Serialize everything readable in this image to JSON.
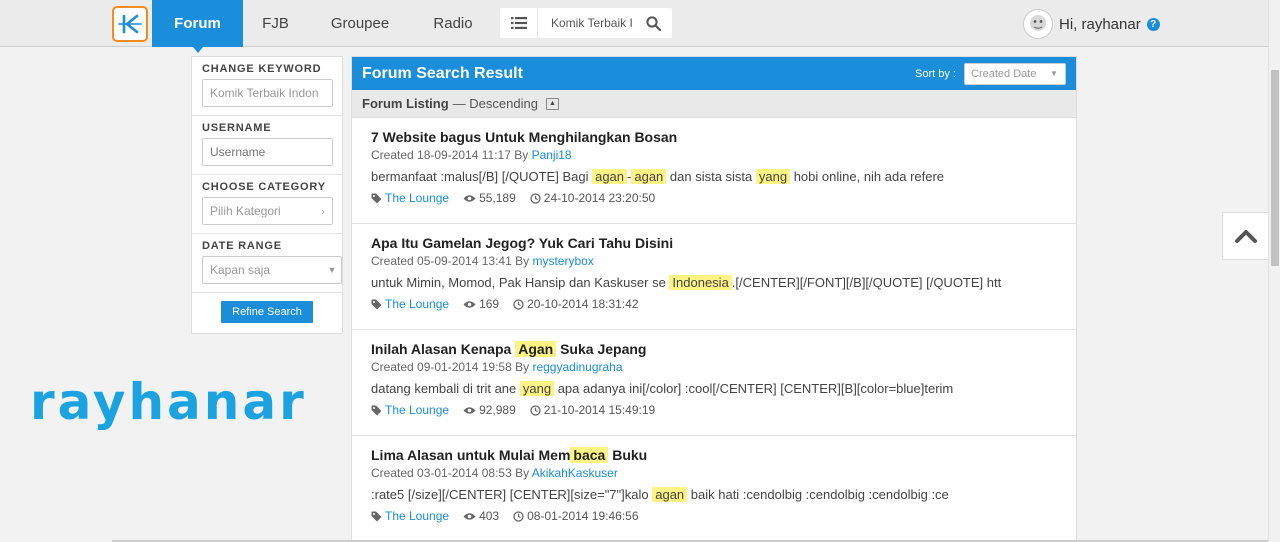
{
  "nav": {
    "items": [
      {
        "label": "Forum",
        "active": true
      },
      {
        "label": "FJB",
        "active": false
      },
      {
        "label": "Groupee",
        "active": false
      },
      {
        "label": "Radio",
        "active": false
      }
    ]
  },
  "search": {
    "value": "Komik Terbaik I",
    "icon": "search-icon"
  },
  "user": {
    "greeting": "Hi, rayhanar",
    "help_icon": "?"
  },
  "sidebar": {
    "keyword": {
      "title": "CHANGE KEYWORD",
      "value": "Komik Terbaik Indon"
    },
    "username": {
      "title": "USERNAME",
      "placeholder": "Username"
    },
    "category": {
      "title": "CHOOSE CATEGORY",
      "value": "Pilih Kategori"
    },
    "date_range": {
      "title": "DATE RANGE",
      "value": "Kapan saja"
    },
    "refine_label": "Refine Search"
  },
  "watermark": "rayhanar",
  "results_panel": {
    "title": "Forum Search Result",
    "sort_label": "Sort by :",
    "sort_value": "Created Date",
    "listing_label": "Forum Listing",
    "listing_order": "— Descending"
  },
  "results": [
    {
      "title": [
        {
          "t": "7 Website bagus Untuk Menghilangkan Bosan"
        }
      ],
      "created": "Created 18-09-2014 11:17 By",
      "author": "Panji18",
      "snippet": [
        {
          "t": "bermanfaat :malus[/B] [/QUOTE] Bagi "
        },
        {
          "t": "agan",
          "hl": true
        },
        {
          "t": "-"
        },
        {
          "t": "agan",
          "hl": true
        },
        {
          "t": " dan sista sista "
        },
        {
          "t": "yang",
          "hl": true
        },
        {
          "t": " hobi online, nih ada refere"
        }
      ],
      "category": "The Lounge",
      "views": "55,189",
      "last_post": "24-10-2014 23:20:50"
    },
    {
      "title": [
        {
          "t": "Apa Itu Gamelan Jegog? Yuk Cari Tahu Disini"
        }
      ],
      "created": "Created 05-09-2014 13:41 By",
      "author": "mysterybox",
      "snippet": [
        {
          "t": "untuk Mimin, Momod, Pak Hansip dan Kaskuser se "
        },
        {
          "t": "Indonesia",
          "hl": true
        },
        {
          "t": ".[/CENTER][/FONT][/B][/QUOTE] [/QUOTE] htt"
        }
      ],
      "category": "The Lounge",
      "views": "169",
      "last_post": "20-10-2014 18:31:42"
    },
    {
      "title": [
        {
          "t": "Inilah Alasan Kenapa "
        },
        {
          "t": "Agan",
          "hl": true
        },
        {
          "t": " Suka Jepang"
        }
      ],
      "created": "Created 09-01-2014 19:58 By",
      "author": "reggyadinugraha",
      "snippet": [
        {
          "t": "datang kembali di trit ane "
        },
        {
          "t": "yang",
          "hl": true
        },
        {
          "t": " apa adanya ini[/color] :cool[/CENTER] [CENTER][B][color=blue]terim"
        }
      ],
      "category": "The Lounge",
      "views": "92,989",
      "last_post": "21-10-2014 15:49:19"
    },
    {
      "title": [
        {
          "t": "Lima Alasan untuk Mulai Mem"
        },
        {
          "t": "baca",
          "hl": true
        },
        {
          "t": " Buku"
        }
      ],
      "created": "Created 03-01-2014 08:53 By",
      "author": "AkikahKaskuser",
      "snippet": [
        {
          "t": ":rate5 [/size][/CENTER] [CENTER][size=\"7\"]kalo "
        },
        {
          "t": "agan",
          "hl": true
        },
        {
          "t": " baik hati :cendolbig :cendolbig :cendolbig :ce"
        }
      ],
      "category": "The Lounge",
      "views": "403",
      "last_post": "08-01-2014 19:46:56"
    }
  ],
  "colors": {
    "accent": "#1a8ddb",
    "logo_border": "#f58a1f",
    "highlight": "#fff483",
    "watermark": "#1aa3e0"
  }
}
